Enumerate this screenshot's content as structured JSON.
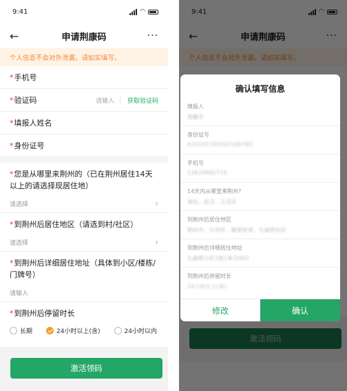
{
  "status": {
    "time": "9:41"
  },
  "header": {
    "back_icon": "←",
    "title": "申请荆康码",
    "more_icon": "···"
  },
  "notice": "个人信息不会对外泄漏，请如实填写。",
  "form": {
    "phone_label": "手机号",
    "code_label": "验证码",
    "code_placeholder": "请输入",
    "get_code_label": "获取验证码",
    "reporter_label": "填报人姓名",
    "id_label": "身份证号",
    "from_label": "您是从哪里来荆州的（已在荆州居住14天以上的请选择现居住地）",
    "from_value": "请选择",
    "district_label": "到荆州后居住地区（请选到村/社区）",
    "district_value": "请选择",
    "address_label": "到荆州后详细居住地址（具体到小区/楼栋/门牌号）",
    "address_placeholder": "请输入",
    "stay_label": "到荆州后停留时长",
    "stay_options": [
      "长期",
      "24小时以上(含)",
      "24小时以内"
    ],
    "stay_selected": "24小时以上(含)",
    "submit_label": "激活领码"
  },
  "modal": {
    "title": "确认填写信息",
    "items": [
      {
        "label": "填报人",
        "value": "周馨宇"
      },
      {
        "label": "身份证号",
        "value": "42010119920216878X"
      },
      {
        "label": "手机号",
        "value": "13829882719"
      },
      {
        "label": "14天内从哪里来荆州?",
        "value": "湖北、武汉、江汉区"
      },
      {
        "label": "到荆州后居住地区",
        "value": "荆州市、沙市区、解放街道、九曲桥社区"
      },
      {
        "label": "到荆州后详细居住地址",
        "value": "九曲桥小区1栋1单元602"
      },
      {
        "label": "到荆州后停留时长",
        "value": "24小时以上(含)"
      }
    ],
    "edit_label": "修改",
    "confirm_label": "确认"
  },
  "colors": {
    "accent": "#24a667",
    "notice_bg": "#fff3e6",
    "notice_text": "#f0883c",
    "required": "#e33333",
    "radio_selected": "#f0a030"
  },
  "icons": {
    "back": "arrow-left-icon",
    "more": "more-icon",
    "chevron": "chevron-right-icon",
    "signal": "signal-icon",
    "wifi": "wifi-icon",
    "battery": "battery-icon"
  }
}
